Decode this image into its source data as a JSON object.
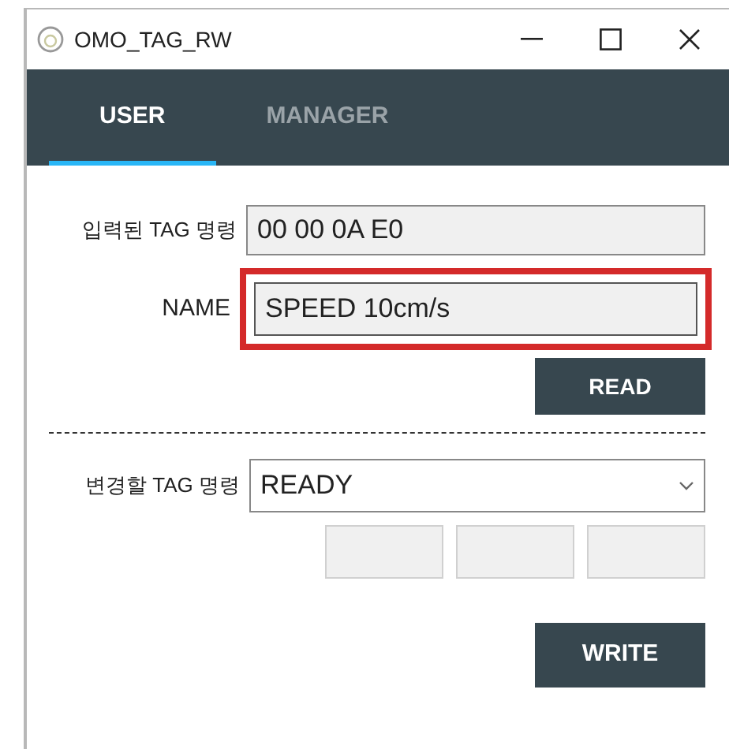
{
  "window": {
    "title": "OMO_TAG_RW"
  },
  "tabs": [
    {
      "label": "USER",
      "selected": true
    },
    {
      "label": "MANAGER",
      "selected": false
    }
  ],
  "read_section": {
    "tag_label": "입력된 TAG 명령",
    "tag_value": "00 00 0A E0",
    "name_label": "NAME",
    "name_value": "SPEED 10cm/s",
    "name_highlighted": true,
    "button": "READ"
  },
  "write_section": {
    "tag_label": "변경할 TAG 명령",
    "tag_value": "READY",
    "byte_fields": [
      {
        "disabled": true
      },
      {
        "disabled": true
      },
      {
        "disabled": true
      }
    ],
    "button": "WRITE"
  }
}
